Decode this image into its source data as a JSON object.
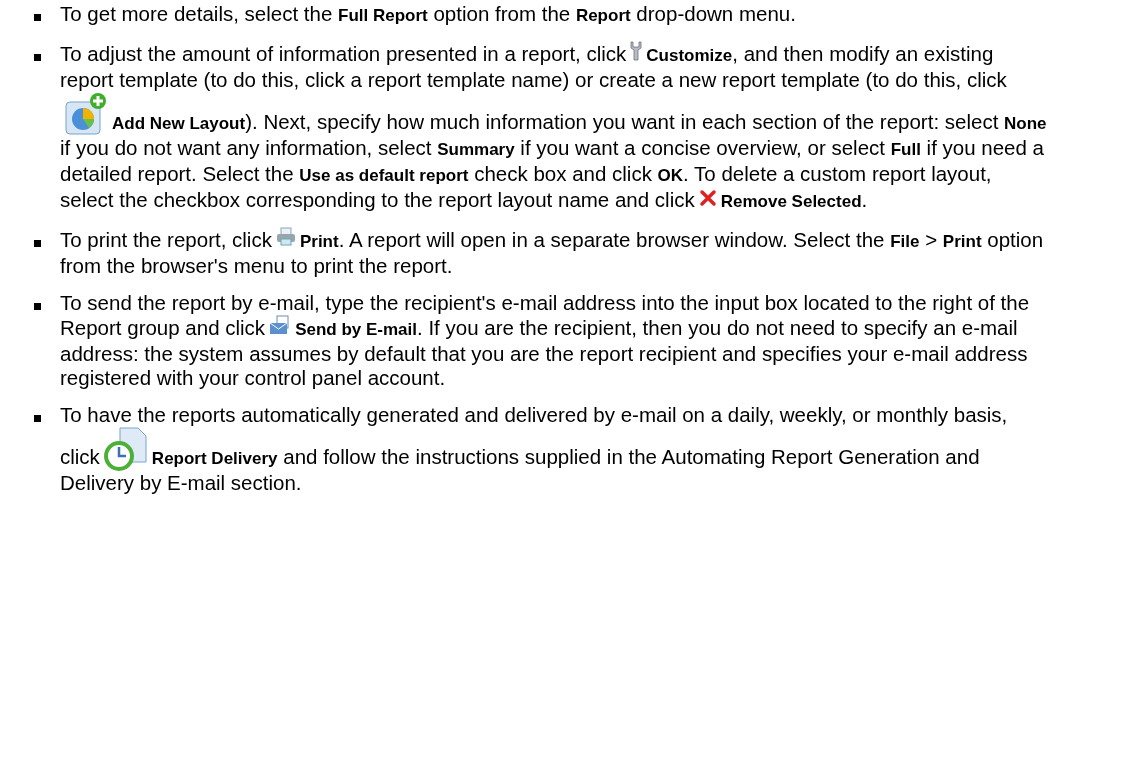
{
  "items": [
    {
      "segments": [
        {
          "kind": "text",
          "text": "To get more details, select the **Full Report** option from the **Report** drop-down menu."
        }
      ]
    },
    {
      "segments": [
        {
          "kind": "text",
          "text": "To adjust the amount of information presented in a report, click"
        },
        {
          "kind": "icon"
        },
        {
          "kind": "text",
          "text": "**Customize**, and then modify an existing report template (to do this, click a report template name) or create a new report template (to do this, click"
        },
        {
          "kind": "icon"
        },
        {
          "kind": "text",
          "text": "**Add New Layout**). Next, specify how much information you want in each section of the report: select **None** if you do not want any information, select **Summary** if you want a concise overview, or select **Full** if you need a detailed report. Select the **Use as default report** check box and click **OK**. To delete a custom report layout, select the checkbox corresponding to the report layout name and click"
        },
        {
          "kind": "icon"
        },
        {
          "kind": "text",
          "text": "**Remove Selected**."
        }
      ]
    },
    {
      "segments": [
        {
          "kind": "text",
          "text": "To print the report, click"
        },
        {
          "kind": "icon"
        },
        {
          "kind": "text",
          "text": "**Print**. A report will open in a separate browser window. Select the **File** > **Print** option from the browser's menu to print the report."
        }
      ]
    },
    {
      "segments": [
        {
          "kind": "text",
          "text": "To send the report by e-mail, type the recipient's e-mail address into the input box located to the right of the Report group and click"
        },
        {
          "kind": "icon"
        },
        {
          "kind": "text",
          "text": "**Send by E-mail**. If you are the recipient, then you do not need to specify an e-mail address: the system assumes by default that you are the report recipient and specifies your e-mail address registered with your control panel account."
        }
      ]
    },
    {
      "segments": [
        {
          "kind": "text",
          "text": "To have the reports automatically generated and delivered by e-mail on a daily, weekly, or monthly basis, click"
        },
        {
          "kind": "icon"
        },
        {
          "kind": "text",
          "text": "**Report Delivery** and follow the instructions supplied in the Automating Report Generation and Delivery by E-mail section."
        }
      ]
    }
  ]
}
